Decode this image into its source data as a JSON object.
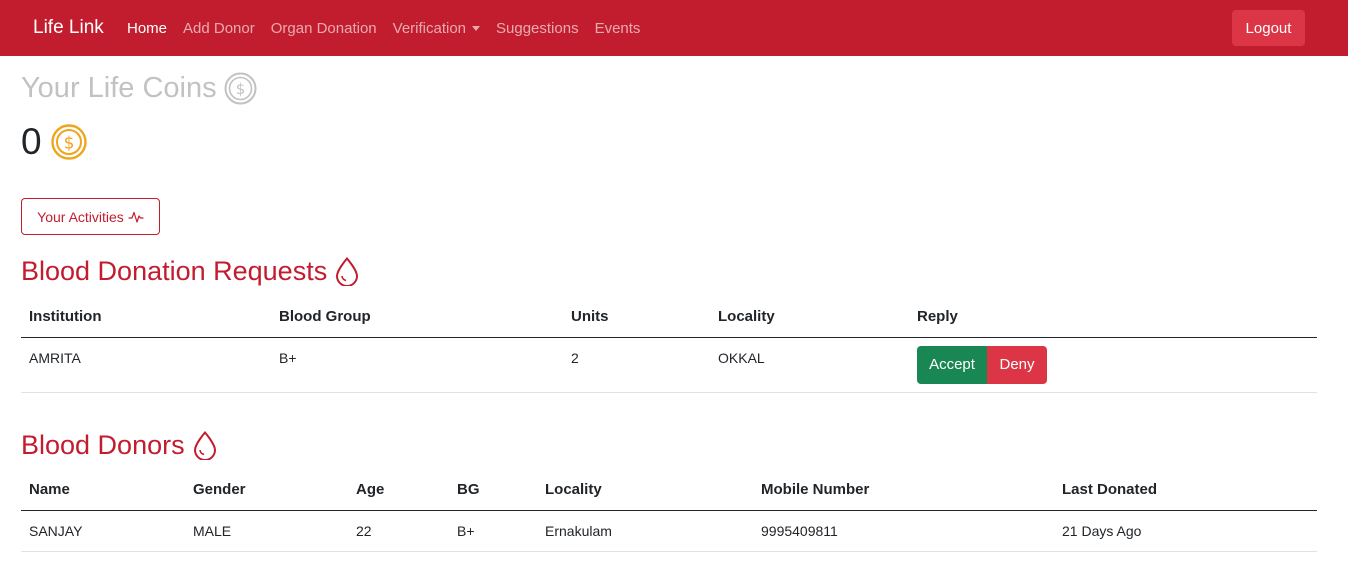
{
  "navbar": {
    "brand": "Life Link",
    "links": [
      "Home",
      "Add Donor",
      "Organ Donation",
      "Verification",
      "Suggestions",
      "Events"
    ],
    "active_link": "Home",
    "logout_label": "Logout",
    "colors": {
      "background": "#c21d2f",
      "logout_button": "#dc3545"
    }
  },
  "coins": {
    "title": "Your Life Coins",
    "value": "0",
    "title_icon": "dollar-coin-outline-icon",
    "value_icon": "dollar-coin-gold-icon",
    "coin_color": "#f0a41e"
  },
  "activities_button": {
    "label": "Your Activities",
    "icon": "activity-pulse-icon"
  },
  "requests": {
    "title": "Blood Donation Requests",
    "icon": "blood-drop-icon",
    "columns": [
      "Institution",
      "Blood Group",
      "Units",
      "Locality",
      "Reply"
    ],
    "rows": [
      {
        "institution": "AMRITA",
        "blood_group": "B+",
        "units": "2",
        "locality": "OKKAL",
        "accept_label": "Accept",
        "deny_label": "Deny"
      }
    ]
  },
  "donors": {
    "title": "Blood Donors",
    "icon": "blood-drop-icon",
    "columns": [
      "Name",
      "Gender",
      "Age",
      "BG",
      "Locality",
      "Mobile Number",
      "Last Donated"
    ],
    "rows": [
      {
        "name": "SANJAY",
        "gender": "MALE",
        "age": "22",
        "bg": "B+",
        "locality": "Ernakulam",
        "mobile": "9995409811",
        "last_donated": "21 Days Ago"
      }
    ]
  },
  "accent_color": "#c21d2f"
}
